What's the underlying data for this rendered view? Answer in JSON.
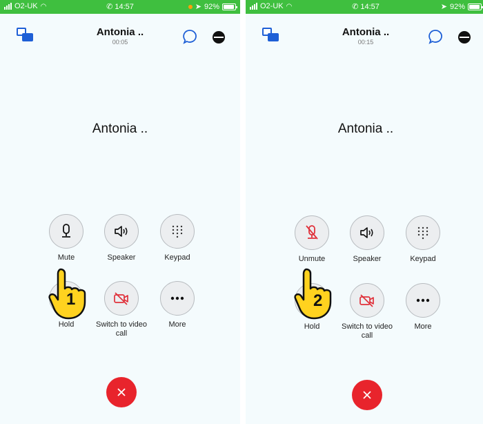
{
  "screens": [
    {
      "status": {
        "carrier": "O2-UK",
        "time": "14:57",
        "battery": "92%"
      },
      "header": {
        "title": "Antonia ..",
        "timer": "00:05"
      },
      "contact_name": "Antonia ..",
      "controls": [
        {
          "label": "Mute",
          "icon": "microphone-icon"
        },
        {
          "label": "Speaker",
          "icon": "speaker-icon"
        },
        {
          "label": "Keypad",
          "icon": "keypad-icon"
        },
        {
          "label": "Hold",
          "icon": "pause-icon"
        },
        {
          "label": "Switch to video call",
          "icon": "video-off-icon"
        },
        {
          "label": "More",
          "icon": "ellipsis-icon"
        }
      ],
      "step_number": "1"
    },
    {
      "status": {
        "carrier": "O2-UK",
        "time": "14:57",
        "battery": "92%"
      },
      "header": {
        "title": "Antonia ..",
        "timer": "00:15"
      },
      "contact_name": "Antonia ..",
      "controls": [
        {
          "label": "Unmute",
          "icon": "microphone-muted-icon"
        },
        {
          "label": "Speaker",
          "icon": "speaker-icon"
        },
        {
          "label": "Keypad",
          "icon": "keypad-icon"
        },
        {
          "label": "Hold",
          "icon": "pause-icon"
        },
        {
          "label": "Switch to video call",
          "icon": "video-off-icon"
        },
        {
          "label": "More",
          "icon": "ellipsis-icon"
        }
      ],
      "step_number": "2"
    }
  ],
  "colors": {
    "status_bar": "#3fbf3f",
    "accent_blue": "#1e5fd6",
    "hangup_red": "#e8242c",
    "muted_red": "#e0303a",
    "pointer_yellow": "#ffd21f"
  }
}
